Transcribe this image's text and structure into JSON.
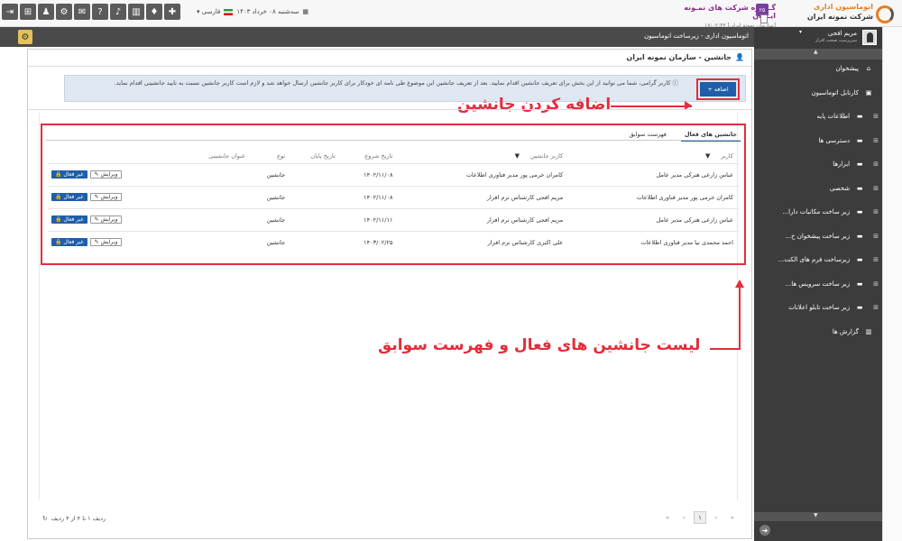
{
  "header": {
    "icons": [
      "exit-icon",
      "sitemap-icon",
      "users-icon",
      "gear-icon",
      "chat-icon",
      "help-icon",
      "mic-icon",
      "chart-icon",
      "bell-icon",
      "puzzle-icon"
    ],
    "icon_glyphs": [
      "⇥",
      "⊞",
      "♟",
      "⚙",
      "✉",
      "?",
      "♪",
      "▥",
      "♦",
      "✚"
    ],
    "date": "سه‌شنبه ۰۸ خرداد ۱۴۰۳",
    "language": "فارسی",
    "org_name": "گـــروه شرکت های نمـونه ایــران",
    "org_sub": "[سازمان نمونه ایران] ۱۷:۰۲:۳۳",
    "org_badge": "۲۵",
    "logo_line1": "اتوماسیون اداری",
    "logo_line2": "شرکت نمونه ایران"
  },
  "titlebar": {
    "title": "اتوماسیون اداری - زیرساخت اتوماسیون"
  },
  "user": {
    "name": "مریم افجی",
    "role": "سرپرست صحت افزار"
  },
  "sidebar": {
    "items": [
      {
        "label": "پیشخوان",
        "icon": "⌂",
        "expandable": false
      },
      {
        "label": "کارتابل اتوماسیون",
        "icon": "▣",
        "expandable": false
      },
      {
        "label": "اطلاعات پایه",
        "icon": "▬",
        "expandable": true
      },
      {
        "label": "دسترسی ها",
        "icon": "▬",
        "expandable": true
      },
      {
        "label": "ابزارها",
        "icon": "▬",
        "expandable": true
      },
      {
        "label": "شخصی",
        "icon": "▬",
        "expandable": true
      },
      {
        "label": "زیر ساخت مکاتبات دارا...",
        "icon": "▬",
        "expandable": true
      },
      {
        "label": "زیر ساخت پیشخوان خ...",
        "icon": "▬",
        "expandable": true
      },
      {
        "label": "زیرساخت فرم های الکت...",
        "icon": "▬",
        "expandable": true
      },
      {
        "label": "زیر ساخت سرویس ها...",
        "icon": "▬",
        "expandable": true
      },
      {
        "label": "زیر ساخت تابلو اعلانات",
        "icon": "▬",
        "expandable": true
      },
      {
        "label": "گزارش ها",
        "icon": "▥",
        "expandable": false
      }
    ]
  },
  "page": {
    "title": "جانشین - سازمان نمونه ایران",
    "info": "کاربر گرامی، شما می توانید از این بخش برای تعریف جانشین اقدام نمایید. بعد از تعریف جانشین این موضوع طی نامه ای خودکار برای کاربر جانشین ارسال خواهد شد و لازم است کاربر جانشین نسبت به تایید جانشینی اقدام نماید.",
    "add_label": "اضافه",
    "annotation_add": "اضافه کردن جانشین",
    "annotation_list": "لیست جانشین های فعال و فهرست سوابق"
  },
  "tabs": [
    "جانشین های فعال",
    "فهرست سوابق"
  ],
  "table": {
    "headers": [
      "کاربر",
      "کاربر جانشین",
      "تاریخ شروع",
      "تاریخ پایان",
      "نوع",
      "عنوان جانشینی"
    ],
    "rows": [
      [
        "عباس زارعی هنرکی مدیر عامل",
        "کامران خرمی پور مدیر فناوری اطلاعات",
        "۱۴۰۲/۱۱/۰۸",
        "",
        "جانشین",
        ""
      ],
      [
        "کامران خرمی پور مدیر فناوری اطلاعات",
        "مریم افجی کارشناس نرم افزار",
        "۱۴۰۲/۱۱/۰۸",
        "",
        "جانشین",
        ""
      ],
      [
        "عباس زارعی هنرکی مدیر عامل",
        "مریم افجی کارشناس نرم افزار",
        "۱۴۰۲/۱۱/۱۱",
        "",
        "جانشین",
        ""
      ],
      [
        "احمد محمدی نیا مدیر فناوری اطلاعات",
        "علی اکبری کارشناس نرم افزار",
        "۱۴۰۳/۰۲/۲۵",
        "",
        "جانشین",
        ""
      ]
    ],
    "edit_label": "ویرایش",
    "inactive_label": "غیر فعال"
  },
  "footer": {
    "record_count": "ردیف ۱ تا ۴ از ۴ ردیف",
    "current_page": "۱"
  }
}
